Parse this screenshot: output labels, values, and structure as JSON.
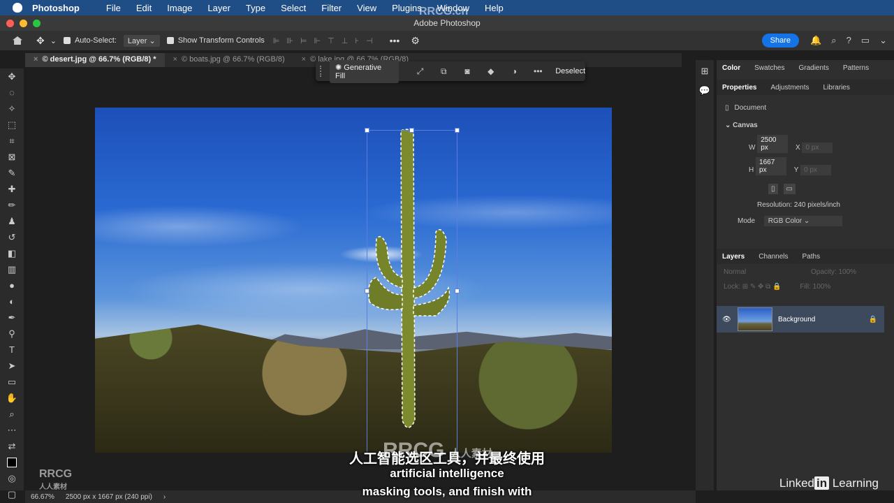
{
  "menubar": {
    "app_name": "Photoshop",
    "items": [
      "File",
      "Edit",
      "Image",
      "Layer",
      "Type",
      "Select",
      "Filter",
      "View",
      "Plugins",
      "Window",
      "Help"
    ]
  },
  "window": {
    "title": "Adobe Photoshop"
  },
  "options": {
    "auto_select_label": "Auto-Select:",
    "auto_select_value": "Layer",
    "transform_label": "Show Transform Controls",
    "share_label": "Share"
  },
  "tabs": [
    {
      "label": "© desert.jpg @ 66.7% (RGB/8) *"
    },
    {
      "label": "© boats.jpg @ 66.7% (RGB/8)"
    },
    {
      "label": "© lake.jpg @ 66.7% (RGB/8)"
    }
  ],
  "taskbar": {
    "generative_fill_label": "Generative Fill",
    "deselect_label": "Deselect"
  },
  "panel": {
    "top_tabs": [
      "Color",
      "Swatches",
      "Gradients",
      "Patterns"
    ],
    "prop_tabs": [
      "Properties",
      "Adjustments",
      "Libraries"
    ],
    "document_label": "Document",
    "canvas_label": "Canvas",
    "w_label": "W",
    "w_value": "2500 px",
    "h_label": "H",
    "h_value": "1667 px",
    "x_label": "X",
    "x_value": "0 px",
    "y_label": "Y",
    "y_value": "0 px",
    "resolution": "Resolution: 240 pixels/inch",
    "mode_label": "Mode",
    "mode_value": "RGB Color",
    "layer_tabs": [
      "Layers",
      "Channels",
      "Paths"
    ],
    "blend_mode": "Normal",
    "opacity_label": "Opacity:",
    "opacity_value": "100%",
    "lock_label": "Lock:",
    "fill_label": "Fill:",
    "fill_value": "100%",
    "layer_name": "Background"
  },
  "status": {
    "zoom": "66.67%",
    "doc_info": "2500 px x 1667 px (240 ppi)"
  },
  "subtitles": {
    "line1": "人工智能选区工具，并最终使用",
    "line2": "artificial intelligence",
    "line3": "masking tools, and finish with"
  },
  "watermarks": {
    "top": "RRCG.cn",
    "center": "RRCG",
    "center_sub": "人人素材",
    "corner": "RRCG",
    "corner_sub": "人人素材",
    "brand": "Linked",
    "brand_in": "in",
    "brand_suffix": " Learning"
  }
}
